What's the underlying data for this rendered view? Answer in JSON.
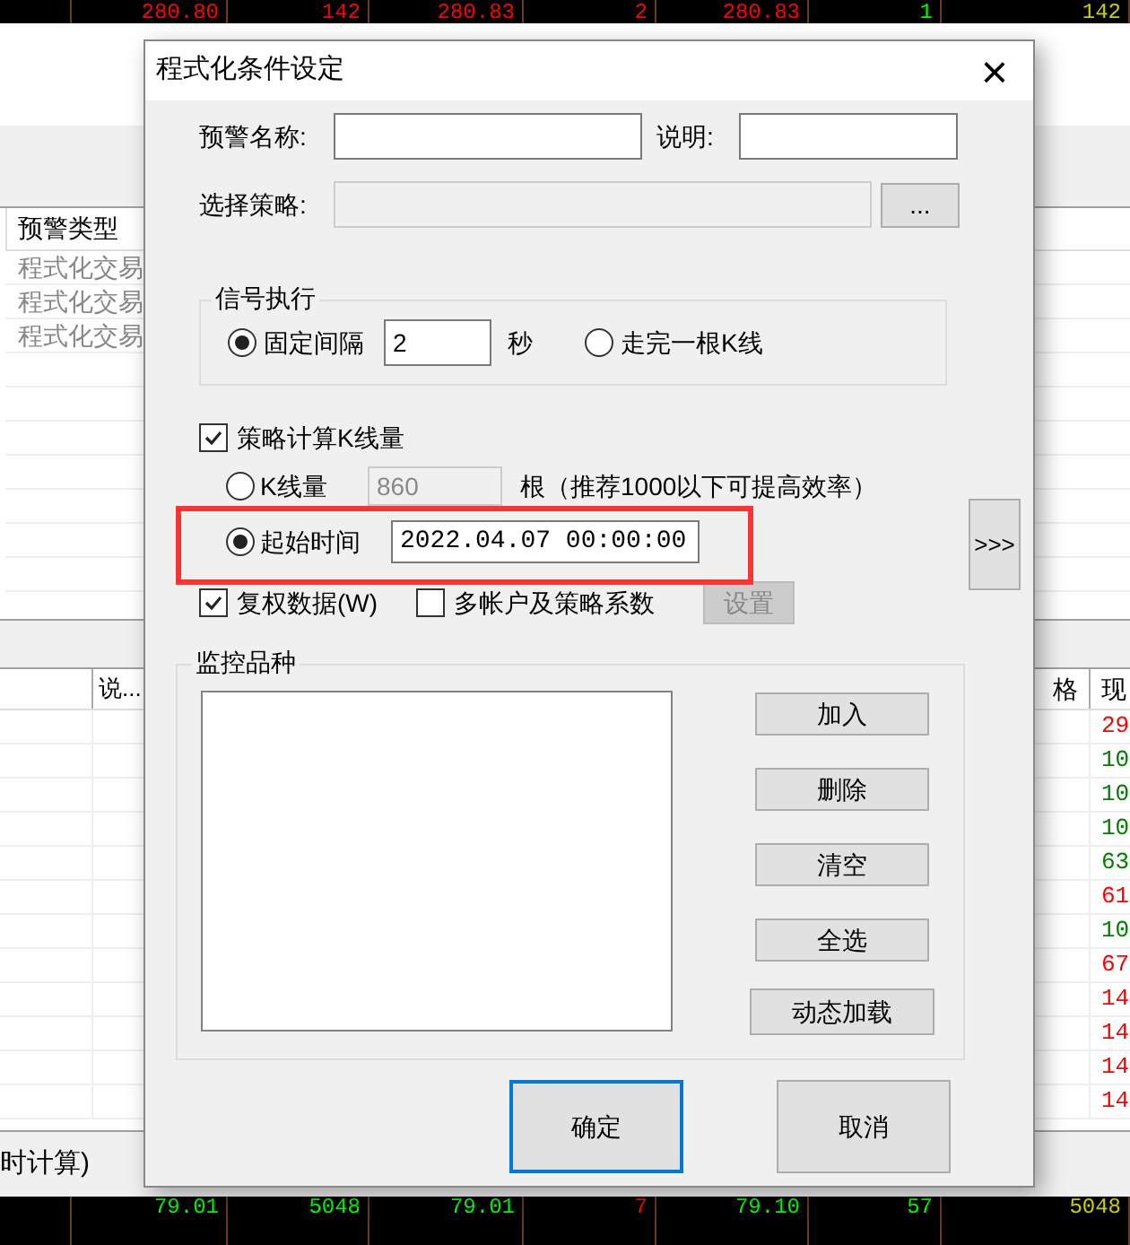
{
  "background": {
    "top_ticker": [
      {
        "text": "280.80",
        "color": "#ff0000"
      },
      {
        "text": "142",
        "color": "#ff0000"
      },
      {
        "text": "280.83",
        "color": "#ff0000"
      },
      {
        "text": "2",
        "color": "#ff0000"
      },
      {
        "text": "280.83",
        "color": "#ff0000"
      },
      {
        "text": "1",
        "color": "#00ff00"
      },
      {
        "text": "142",
        "color": "#cccc00"
      }
    ],
    "alert_table": {
      "columns": [
        "预警类型"
      ],
      "rows": [
        "程式化交易",
        "程式化交易",
        "程式化交易"
      ]
    },
    "lower_table": {
      "columns": [
        "说...",
        "格",
        "现"
      ],
      "rows": [
        {
          "value": "29",
          "color": "#ff0000"
        },
        {
          "value": "10",
          "color": "#008000"
        },
        {
          "value": "10",
          "color": "#008000"
        },
        {
          "value": "10",
          "color": "#008000"
        },
        {
          "value": "63",
          "color": "#008000"
        },
        {
          "value": "61",
          "color": "#ff0000"
        },
        {
          "value": "10",
          "color": "#008000"
        },
        {
          "value": "67",
          "color": "#ff0000"
        },
        {
          "value": "14",
          "color": "#ff0000"
        },
        {
          "value": "14",
          "color": "#ff0000"
        },
        {
          "value": "14",
          "color": "#ff0000"
        },
        {
          "value": "14",
          "color": "#ff0000"
        }
      ]
    },
    "footer_text": "时计算)",
    "bottom_ticker": [
      {
        "text": "79.01",
        "color": "#00ff00"
      },
      {
        "text": "5048",
        "color": "#00ff00"
      },
      {
        "text": "79.01",
        "color": "#00ff00"
      },
      {
        "text": "7",
        "color": "#ff0000"
      },
      {
        "text": "79.10",
        "color": "#00ff00"
      },
      {
        "text": "57",
        "color": "#00ff00"
      },
      {
        "text": "5048",
        "color": "#cccc00"
      }
    ]
  },
  "dialog": {
    "title": "程式化条件设定",
    "close": "×",
    "alert_name": {
      "label": "预警名称:"
    },
    "description": {
      "label": "说明:"
    },
    "strategy": {
      "label": "选择策略:",
      "disabled": true,
      "browse": "..."
    },
    "signal_group": {
      "title": "信号执行",
      "options": [
        {
          "label": "固定间隔",
          "selected": true,
          "value": "2",
          "unit": "秒"
        },
        {
          "label": "走完一根K线",
          "selected": false
        }
      ]
    },
    "kline_count": {
      "label": "策略计算K线量",
      "checked": true,
      "options": [
        {
          "label": "K线量",
          "selected": false,
          "value": "860",
          "disabled": true,
          "hint": "根（推荐1000以下可提高效率）"
        },
        {
          "label": "起始时间",
          "selected": true,
          "value": "2022.04.07 00:00:00",
          "disabled": false
        }
      ]
    },
    "highlighted": true,
    "expand": ">>>",
    "adjusted_data": {
      "label": "复权数据(W)",
      "checked": true
    },
    "multi_account": {
      "label": "多帐户及策略系数",
      "checked": false
    },
    "settings_button": {
      "label": "设置",
      "disabled": true
    },
    "monitor_group": {
      "title": "监控品种",
      "buttons": [
        "加入",
        "删除",
        "清空",
        "全选",
        "动态加载"
      ]
    },
    "buttons": [
      {
        "label": "确定",
        "default": true
      },
      {
        "label": "取消",
        "default": false
      }
    ]
  }
}
